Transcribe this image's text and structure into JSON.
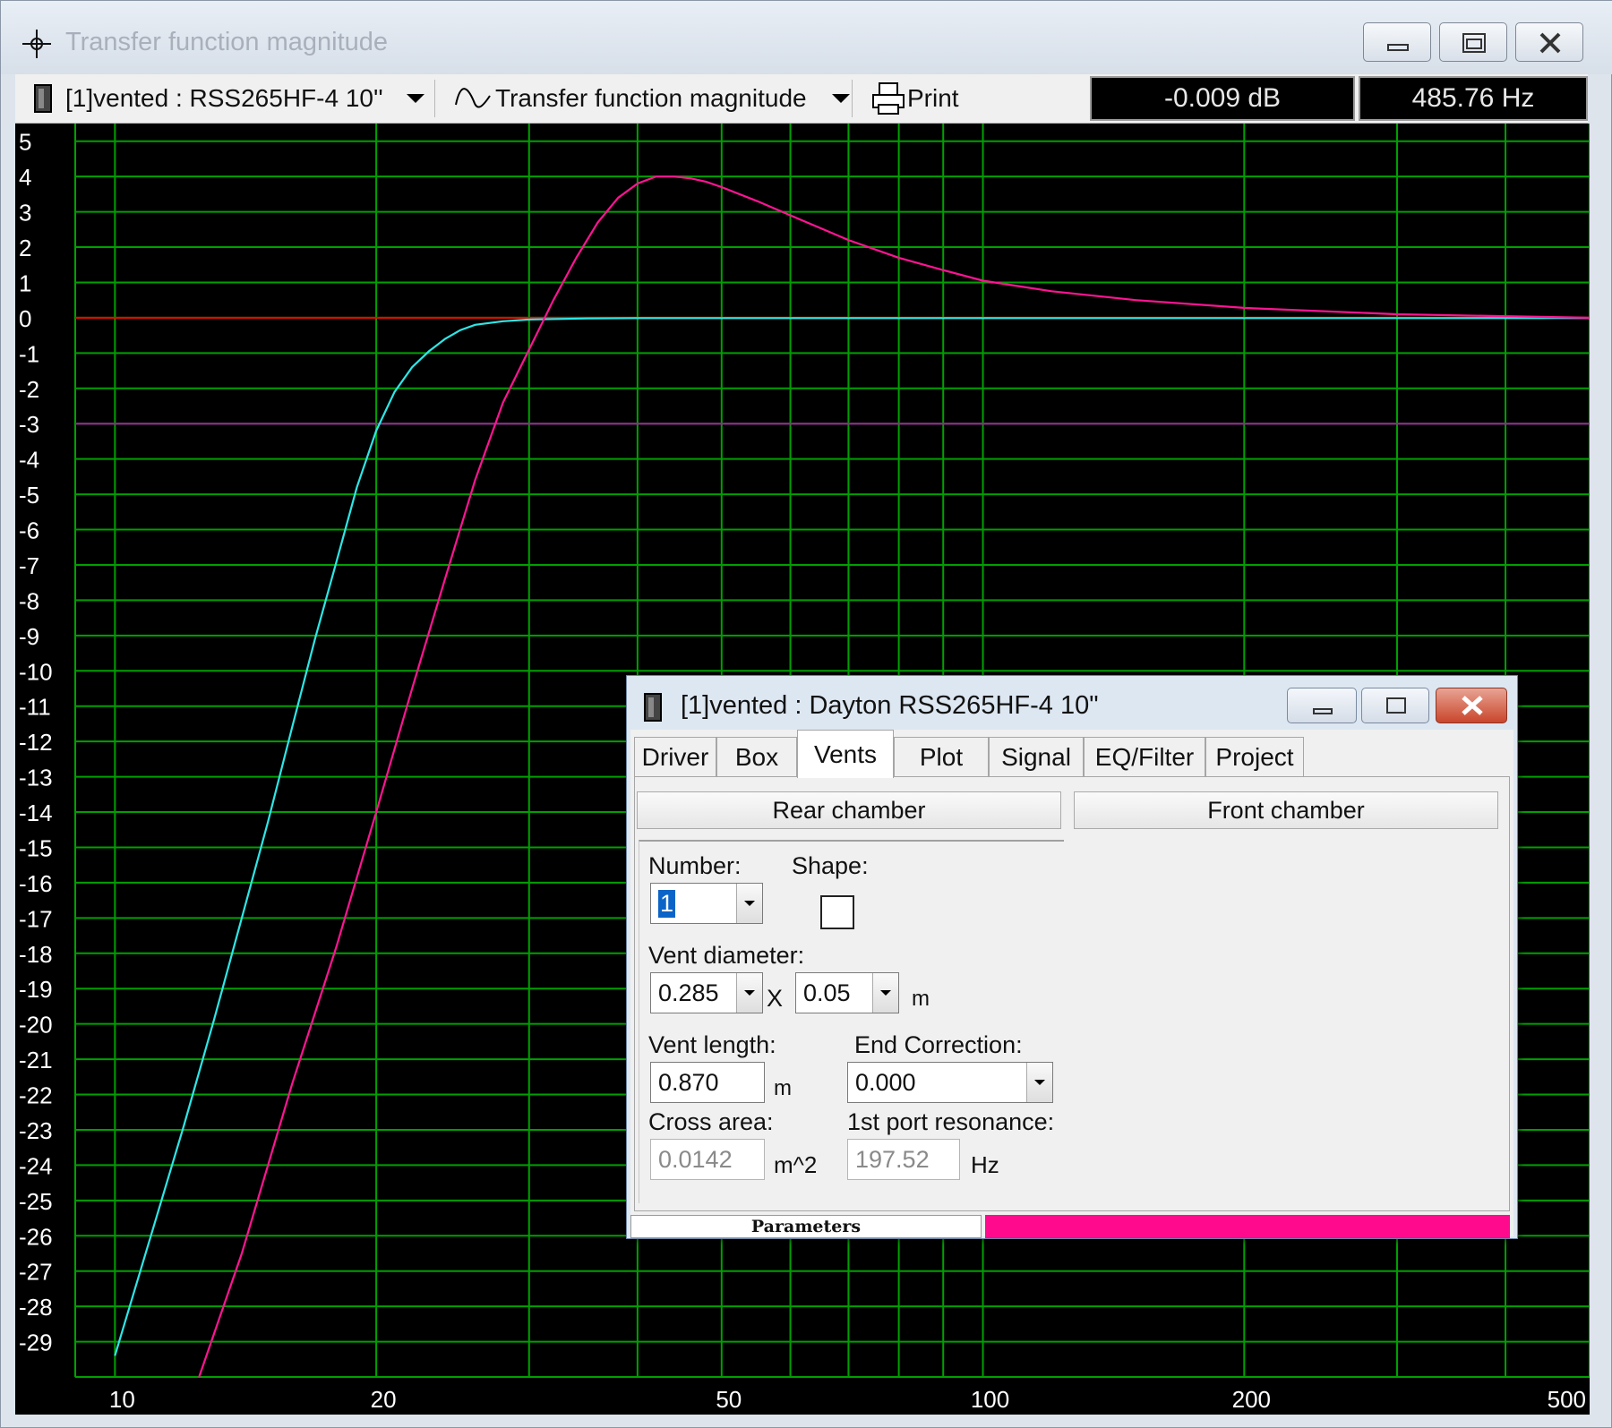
{
  "window": {
    "title": "Transfer function magnitude"
  },
  "toolbar": {
    "project_select": "[1]vented : RSS265HF-4 10''",
    "graph_select": "Transfer function magnitude",
    "print_label": "Print",
    "readout_db": "-0.009 dB",
    "readout_hz": "485.76 Hz"
  },
  "colors": {
    "plot_background": "#000000",
    "grid": "#00a000",
    "axis_text": "#ffffff",
    "curve_cyan": "#2ee6e6",
    "curve_magenta": "#ff1493",
    "ref_line_red": "#ff0000",
    "ref_line_purple": "#a020a0",
    "status_bar_pink": "#ff0a8c"
  },
  "chart_data": {
    "type": "line",
    "title": "",
    "xlabel": "",
    "ylabel": "",
    "xscale": "log",
    "xlim": [
      9,
      500
    ],
    "ylim": [
      -30,
      5.5
    ],
    "grid": true,
    "y_ticks": [
      5,
      4,
      3,
      2,
      1,
      0,
      -1,
      -2,
      -3,
      -4,
      -5,
      -6,
      -7,
      -8,
      -9,
      -10,
      -11,
      -12,
      -13,
      -14,
      -15,
      -16,
      -17,
      -18,
      -19,
      -20,
      -21,
      -22,
      -23,
      -24,
      -25,
      -26,
      -27,
      -28,
      -29
    ],
    "x_tick_labels": [
      "10",
      "20",
      "50",
      "100",
      "200",
      "500"
    ],
    "x_tick_values": [
      10,
      20,
      50,
      100,
      200,
      500
    ],
    "x_gridlines": [
      10,
      20,
      30,
      40,
      50,
      60,
      70,
      80,
      90,
      100,
      200,
      300,
      400,
      500
    ],
    "reference_lines": [
      {
        "y": 0,
        "color": "#ff0000"
      },
      {
        "y": -3,
        "color": "#a020a0"
      }
    ],
    "series": [
      {
        "color": "#2ee6e6",
        "x": [
          10,
          11,
          12,
          13,
          14,
          15,
          16,
          17,
          18,
          19,
          20,
          21,
          22,
          23,
          24,
          25,
          26,
          28,
          30,
          35,
          40,
          50,
          70,
          100,
          200,
          500
        ],
        "y": [
          -29.4,
          -26.0,
          -22.9,
          -19.9,
          -17.0,
          -14.3,
          -11.6,
          -9.1,
          -6.9,
          -4.8,
          -3.2,
          -2.1,
          -1.4,
          -0.95,
          -0.6,
          -0.35,
          -0.2,
          -0.1,
          -0.05,
          -0.02,
          -0.01,
          -0.01,
          -0.01,
          -0.01,
          -0.01,
          -0.01
        ]
      },
      {
        "color": "#ff1493",
        "x": [
          12.5,
          14,
          16,
          18,
          20,
          22,
          24,
          26,
          28,
          30,
          32,
          34,
          36,
          38,
          40,
          42,
          44,
          46,
          48,
          50,
          55,
          60,
          70,
          80,
          90,
          100,
          120,
          150,
          200,
          300,
          500
        ],
        "y": [
          -30.0,
          -26.5,
          -21.7,
          -17.8,
          -14.0,
          -10.5,
          -7.4,
          -4.6,
          -2.4,
          -0.9,
          0.5,
          1.7,
          2.7,
          3.4,
          3.8,
          4.0,
          4.0,
          3.95,
          3.85,
          3.7,
          3.3,
          2.9,
          2.2,
          1.7,
          1.35,
          1.05,
          0.75,
          0.5,
          0.28,
          0.1,
          0.0
        ]
      }
    ]
  },
  "dialog": {
    "title": "[1]vented : Dayton RSS265HF-4 10\"",
    "tabs": [
      "Driver",
      "Box",
      "Vents",
      "Plot",
      "Signal",
      "EQ/Filter",
      "Project"
    ],
    "active_tab": "Vents",
    "rear_chamber_label": "Rear chamber",
    "front_chamber_label": "Front chamber",
    "number_label": "Number:",
    "number_value": "1",
    "shape_label": "Shape:",
    "vent_diameter_label": "Vent diameter:",
    "vent_diameter_1": "0.285",
    "times_symbol": "X",
    "vent_diameter_2": "0.05",
    "diameter_unit": "m",
    "vent_length_label": "Vent length:",
    "vent_length_value": "0.870",
    "vent_length_unit": "m",
    "end_correction_label": "End Correction:",
    "end_correction_value": "0.000",
    "cross_area_label": "Cross area:",
    "cross_area_value": "0.0142",
    "cross_area_unit": "m^2",
    "port_resonance_label": "1st port resonance:",
    "port_resonance_value": "197.52",
    "port_resonance_unit": "Hz",
    "status_label": "Parameters"
  }
}
